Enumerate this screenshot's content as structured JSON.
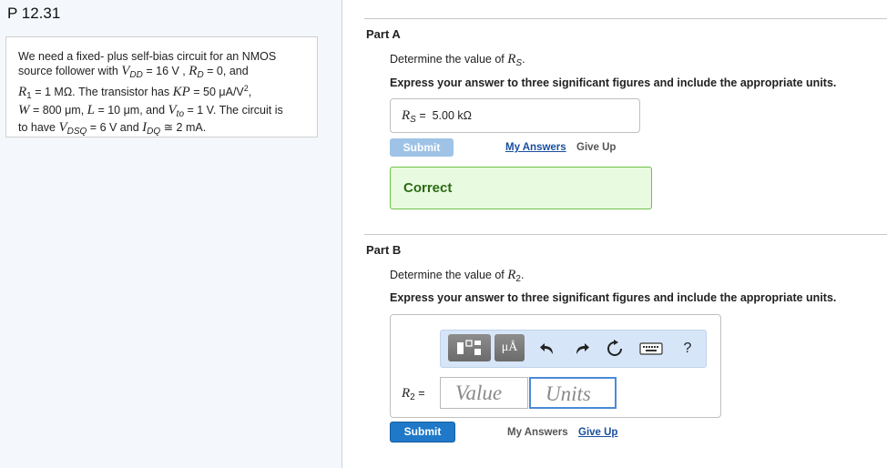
{
  "problem": {
    "id": "P 12.31",
    "text": {
      "t1": "We need a fixed- plus self-bias circuit for an NMOS",
      "t2": "source follower with ",
      "vdd_sym": "V",
      "vdd_sub": "DD",
      "t3": " = 16 V , ",
      "rd_sym": "R",
      "rd_sub": "D",
      "t4": " = 0, and",
      "r1_sym": "R",
      "r1_sub": "1",
      "t5": " = 1 MΩ. The transistor has ",
      "kp_sym": "KP",
      "t6": " = 50 μA/V",
      "t6_sup": "2",
      "t6b": ",",
      "w_sym": "W",
      "t7": " = 800 μm, ",
      "l_sym": "L",
      "t8": " = 10 μm, and ",
      "vto_sym": "V",
      "vto_sub": "to",
      "t9": " = 1 V. The circuit is",
      "t10": "to have ",
      "vdsq_sym": "V",
      "vdsq_sub": "DSQ",
      "t11": " = 6 V and ",
      "idq_sym": "I",
      "idq_sub": "DQ",
      "t12": " ≅ 2 mA."
    }
  },
  "partA": {
    "header": "Part A",
    "question": "Determine the value of ",
    "question_sym": "R",
    "question_sub": "S",
    "question_end": ".",
    "instruction": "Express your answer to three significant figures and include the appropriate units.",
    "answer_label_sym": "R",
    "answer_label_sub": "S",
    "answer_label_eq": " = ",
    "answer_value": "5.00 kΩ",
    "submit_label": "Submit",
    "my_answers_label": "My Answers",
    "give_up_label": "Give Up",
    "feedback": "Correct"
  },
  "partB": {
    "header": "Part B",
    "question": "Determine the value of ",
    "question_sym": "R",
    "question_sub": "2",
    "question_end": ".",
    "instruction": "Express your answer to three significant figures and include the appropriate units.",
    "answer_label_sym": "R",
    "answer_label_sub": "2",
    "answer_label_eq": " = ",
    "value_placeholder": "Value",
    "units_placeholder": "Units",
    "units_tool_label": "μÅ",
    "help_label": "?",
    "submit_label": "Submit",
    "my_answers_label": "My Answers",
    "give_up_label": "Give Up"
  },
  "colors": {
    "primary_button": "#1f78c8",
    "correct_bg": "#e8fbe0",
    "correct_border": "#6fbf47",
    "toolbar_bg": "#d6e6f8"
  }
}
